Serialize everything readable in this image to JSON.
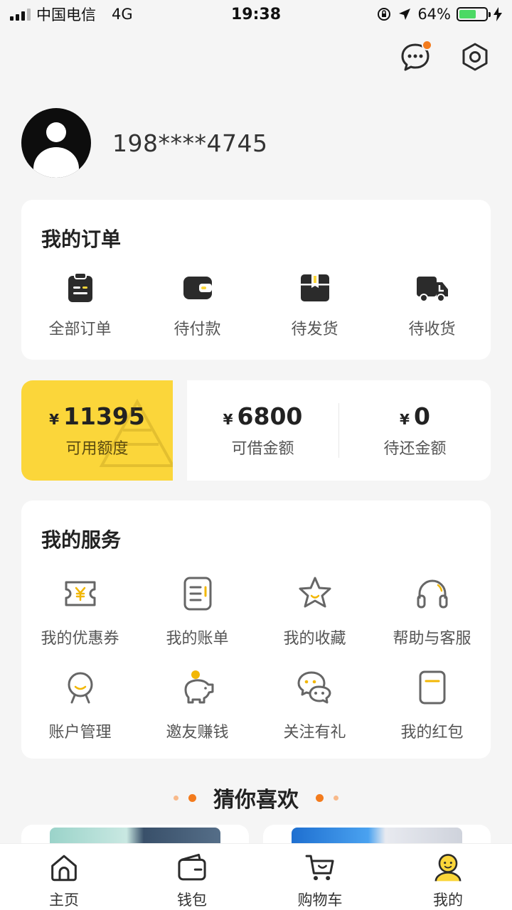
{
  "status_bar": {
    "carrier": "中国电信",
    "network": "4G",
    "time": "19:38",
    "battery": "64%",
    "battery_level": 0.64
  },
  "header": {
    "has_unread_message": true
  },
  "profile": {
    "phone": "198****4745"
  },
  "orders": {
    "title": "我的订单",
    "items": [
      {
        "label": "全部订单",
        "icon": "clipboard-icon"
      },
      {
        "label": "待付款",
        "icon": "wallet-icon"
      },
      {
        "label": "待发货",
        "icon": "package-icon"
      },
      {
        "label": "待收货",
        "icon": "truck-icon"
      }
    ]
  },
  "credit": {
    "currency": "¥",
    "available": {
      "value": "11395",
      "label": "可用额度"
    },
    "borrowable": {
      "value": "6800",
      "label": "可借金额"
    },
    "to_repay": {
      "value": "0",
      "label": "待还金额"
    }
  },
  "services": {
    "title": "我的服务",
    "items": [
      {
        "label": "我的优惠券",
        "icon": "coupon-icon"
      },
      {
        "label": "我的账单",
        "icon": "bill-icon"
      },
      {
        "label": "我的收藏",
        "icon": "star-icon"
      },
      {
        "label": "帮助与客服",
        "icon": "headset-icon"
      },
      {
        "label": "账户管理",
        "icon": "account-icon"
      },
      {
        "label": "邀友赚钱",
        "icon": "piggy-bank-icon"
      },
      {
        "label": "关注有礼",
        "icon": "wechat-icon"
      },
      {
        "label": "我的红包",
        "icon": "red-envelope-icon"
      }
    ]
  },
  "recommend": {
    "title": "猜你喜欢"
  },
  "tabbar": {
    "items": [
      {
        "label": "主页",
        "icon": "home-icon"
      },
      {
        "label": "钱包",
        "icon": "wallet-icon"
      },
      {
        "label": "购物车",
        "icon": "cart-icon"
      },
      {
        "label": "我的",
        "icon": "profile-icon",
        "active": true
      }
    ]
  },
  "colors": {
    "accent": "#fbd63a",
    "notification": "#f37b1d",
    "icon_dark": "#2b2b2b",
    "icon_outline": "#666666"
  }
}
